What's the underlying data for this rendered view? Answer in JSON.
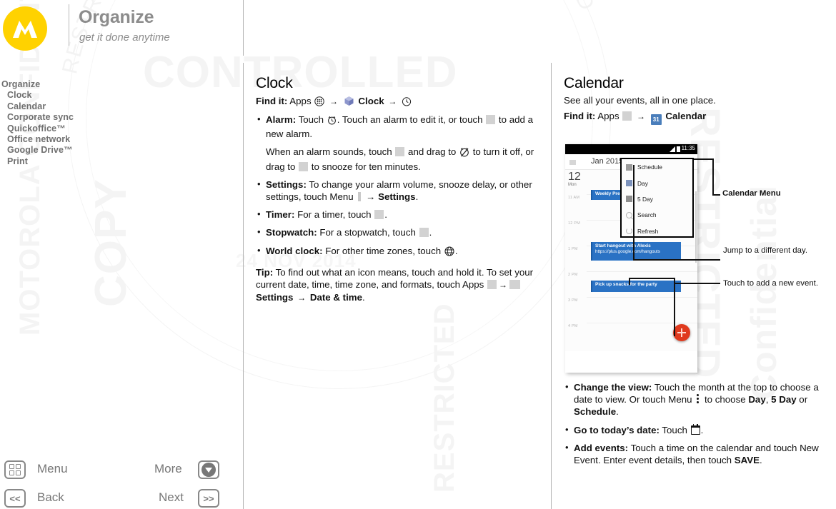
{
  "header": {
    "title": "Organize",
    "subtitle": "get it done anytime",
    "logo_icon": "motorola-logo-icon"
  },
  "toc": {
    "items": [
      {
        "label": "Organize",
        "sub": false
      },
      {
        "label": "Clock",
        "sub": true
      },
      {
        "label": "Calendar",
        "sub": true
      },
      {
        "label": "Corporate sync",
        "sub": true
      },
      {
        "label": "Quickoffice™",
        "sub": true
      },
      {
        "label": "Office network",
        "sub": true
      },
      {
        "label": "Google Drive™",
        "sub": true
      },
      {
        "label": "Print",
        "sub": true
      }
    ]
  },
  "watermark": {
    "arc_text": "RESTRICTED :: MOTOROLA CONFIDENTIAL :: RESTRICTED",
    "line1": "CONTROLLED",
    "line2": "COPY",
    "line3": "RESTRICTED",
    "line4": "MOTOROLA CONFIDENTIAL",
    "line5": "RESTRICTED",
    "line6": "24 NOV 2014",
    "line7": "Confidential"
  },
  "clock": {
    "heading": "Clock",
    "findit_label": "Find it:",
    "findit_apps": "Apps",
    "findit_arrow": "→",
    "findit_app": "Clock",
    "bullets": [
      {
        "term": "Alarm:",
        "text_a": " Touch ",
        "text_b": ". Touch an alarm to edit it, or touch ",
        "text_c": " to add a new alarm."
      },
      {
        "term": "Settings:",
        "text_a": " To change your alarm volume, snooze delay, or other settings, touch Menu ",
        "text_b": " → ",
        "bold_b": "Settings",
        "text_c": "."
      },
      {
        "term": "Timer:",
        "text_a": " For a timer, touch ",
        "text_c": "."
      },
      {
        "term": "Stopwatch:",
        "text_a": " For a stopwatch, touch ",
        "text_c": "."
      },
      {
        "term": "World clock:",
        "text_a": " For other time zones, touch ",
        "text_c": "."
      }
    ],
    "alarm_sub_a": "When an alarm sounds, touch ",
    "alarm_sub_b": " and drag to ",
    "alarm_sub_c": " to turn it off, or drag to ",
    "alarm_sub_d": " to snooze for ten minutes.",
    "tip_label": "Tip:",
    "tip_a": " To find out what an icon means, touch and hold it. To set your current date, time, time zone, and formats, touch Apps ",
    "tip_arrow1": "→",
    "tip_settings": "Settings",
    "tip_arrow2": "→",
    "tip_datetime": "Date & time",
    "tip_end": "."
  },
  "calendar": {
    "heading": "Calendar",
    "lead": "See all your events, all in one place.",
    "findit_label": "Find it:",
    "findit_apps": "Apps",
    "findit_arrow": "→",
    "findit_app": "Calendar",
    "app_icon_label": "31",
    "bullets": [
      {
        "term": "Change the view:",
        "text_a": " Touch the month at the top to choose a date to view. Or touch Menu ",
        "text_b": " to choose ",
        "bold_1": "Day",
        "sep_1": ", ",
        "bold_2": "5 Day",
        "sep_2": " or ",
        "bold_3": "Schedule",
        "text_c": "."
      },
      {
        "term": "Go to today’s date:",
        "text_a": " Touch ",
        "text_c": "."
      },
      {
        "term": "Add events:",
        "text_a": " Touch a time on the calendar and touch New Event. Enter event details, then touch ",
        "bold_1": "SAVE",
        "text_c": "."
      }
    ]
  },
  "phone": {
    "status_time": "11:35",
    "month_label": "Jan 2015",
    "day_number": "12",
    "day_name": "Mon",
    "time_labels": [
      "11 AM",
      "12 PM",
      "1 PM",
      "2 PM",
      "3 PM",
      "4 PM"
    ],
    "events": [
      {
        "title": "Weekly Presentation",
        "subtitle": ""
      },
      {
        "title": "Start hangout with Alexis",
        "subtitle": "https://plus.google.com/hangouts"
      },
      {
        "title": "Pick up snacks for the party",
        "subtitle": ""
      }
    ],
    "fab_label": "+",
    "menu_items": [
      {
        "label": "Schedule",
        "icon": "schedule-icon"
      },
      {
        "label": "Day",
        "icon": "day-icon"
      },
      {
        "label": "5 Day",
        "icon": "five-day-icon"
      },
      {
        "label": "Search",
        "icon": "search-icon"
      },
      {
        "label": "Refresh",
        "icon": "refresh-icon"
      }
    ],
    "nav": [
      "back-icon",
      "home-icon",
      "recents-icon"
    ]
  },
  "callouts": [
    {
      "label": "Calendar Menu",
      "bold": true
    },
    {
      "label": "Jump to a different day.",
      "bold": false
    },
    {
      "label": "Touch to add a new event.",
      "bold": false
    }
  ],
  "footer": {
    "menu_label": "Menu",
    "back_label": "Back",
    "more_label": "More",
    "next_label": "Next",
    "back_glyph": "<<",
    "next_glyph": ">>"
  },
  "colors": {
    "brand_yellow": "#ffd200",
    "event_blue": "#2a72c4",
    "fab_red": "#e03a1e",
    "cal_icon_blue": "#4a7ebb",
    "toc_gray": "#6f6f6f"
  }
}
